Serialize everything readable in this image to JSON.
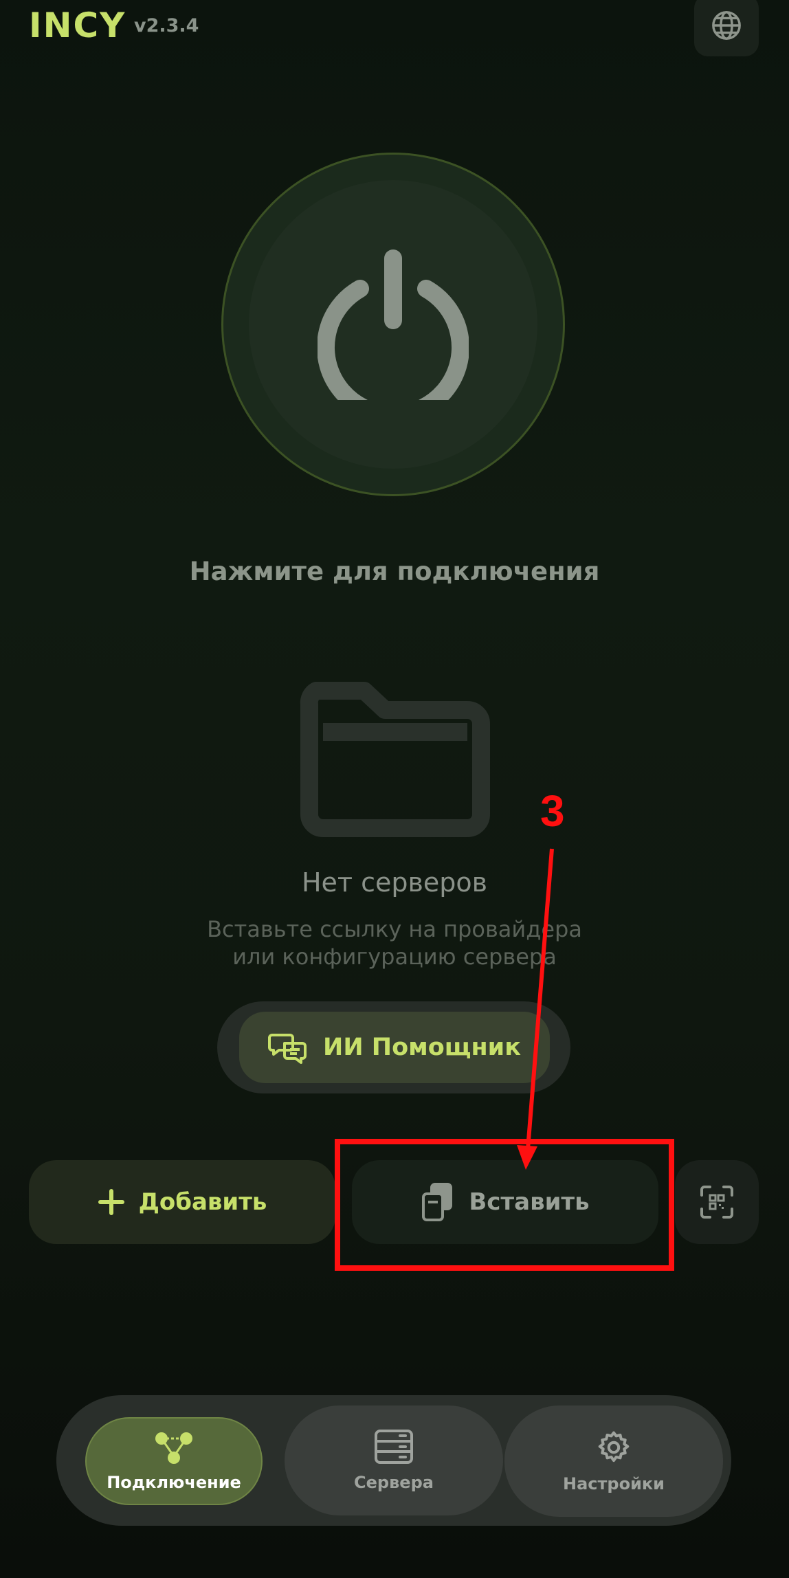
{
  "header": {
    "brand": "INCY",
    "version": "v2.3.4",
    "globe_icon": "globe-icon"
  },
  "power": {
    "icon": "power-icon",
    "hint": "Нажмите для подключения"
  },
  "empty_state": {
    "icon": "folder-icon",
    "title": "Нет серверов",
    "description_line1": "Вставьте ссылку на провайдера",
    "description_line2": "или конфигурацию сервера"
  },
  "ai_assistant": {
    "label": "ИИ Помощник",
    "icon": "chat-bubbles-icon"
  },
  "actions": {
    "add_label": "Добавить",
    "paste_label": "Вставить",
    "qr_icon": "qr-scan-icon"
  },
  "annotation": {
    "step": "3",
    "color": "#ff1010"
  },
  "nav": {
    "items": [
      {
        "label": "Подключение",
        "icon": "connection-icon",
        "active": true
      },
      {
        "label": "Сервера",
        "icon": "server-stack-icon",
        "active": false
      },
      {
        "label": "Настройки",
        "icon": "gear-icon",
        "active": false
      }
    ]
  },
  "colors": {
    "accent": "#c7e06a",
    "background": "#0f170f",
    "muted_text": "#8b928a"
  }
}
